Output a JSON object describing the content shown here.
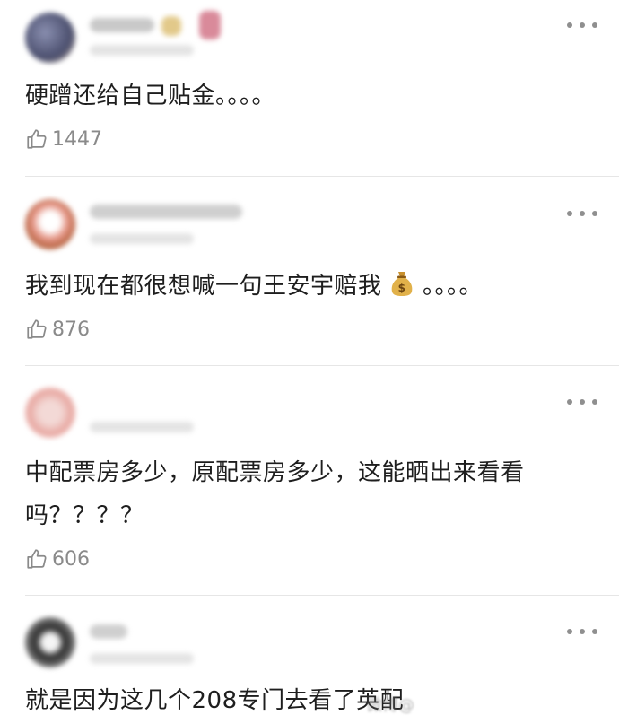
{
  "comments": [
    {
      "text": "硬蹭还给自己贴金。。。。",
      "likes": "1447"
    },
    {
      "text": "我到现在都很想喊一句王安宇赔我",
      "text_suffix": "。。。。",
      "likes": "876"
    },
    {
      "text_line1": "中配票房多少，原配票房多少，这能晒出来看看",
      "text_line2": "吗？？？？",
      "likes": "606"
    },
    {
      "text": "就是因为这几个208专门去看了英配"
    }
  ],
  "icons": {
    "more": "more-horizontal-icon",
    "like": "thumbs-up-icon",
    "emoji": "money-bag-icon"
  },
  "colors": {
    "text": "#1e1e1e",
    "meta": "#8a8a8a",
    "divider": "#e6e6e6"
  }
}
